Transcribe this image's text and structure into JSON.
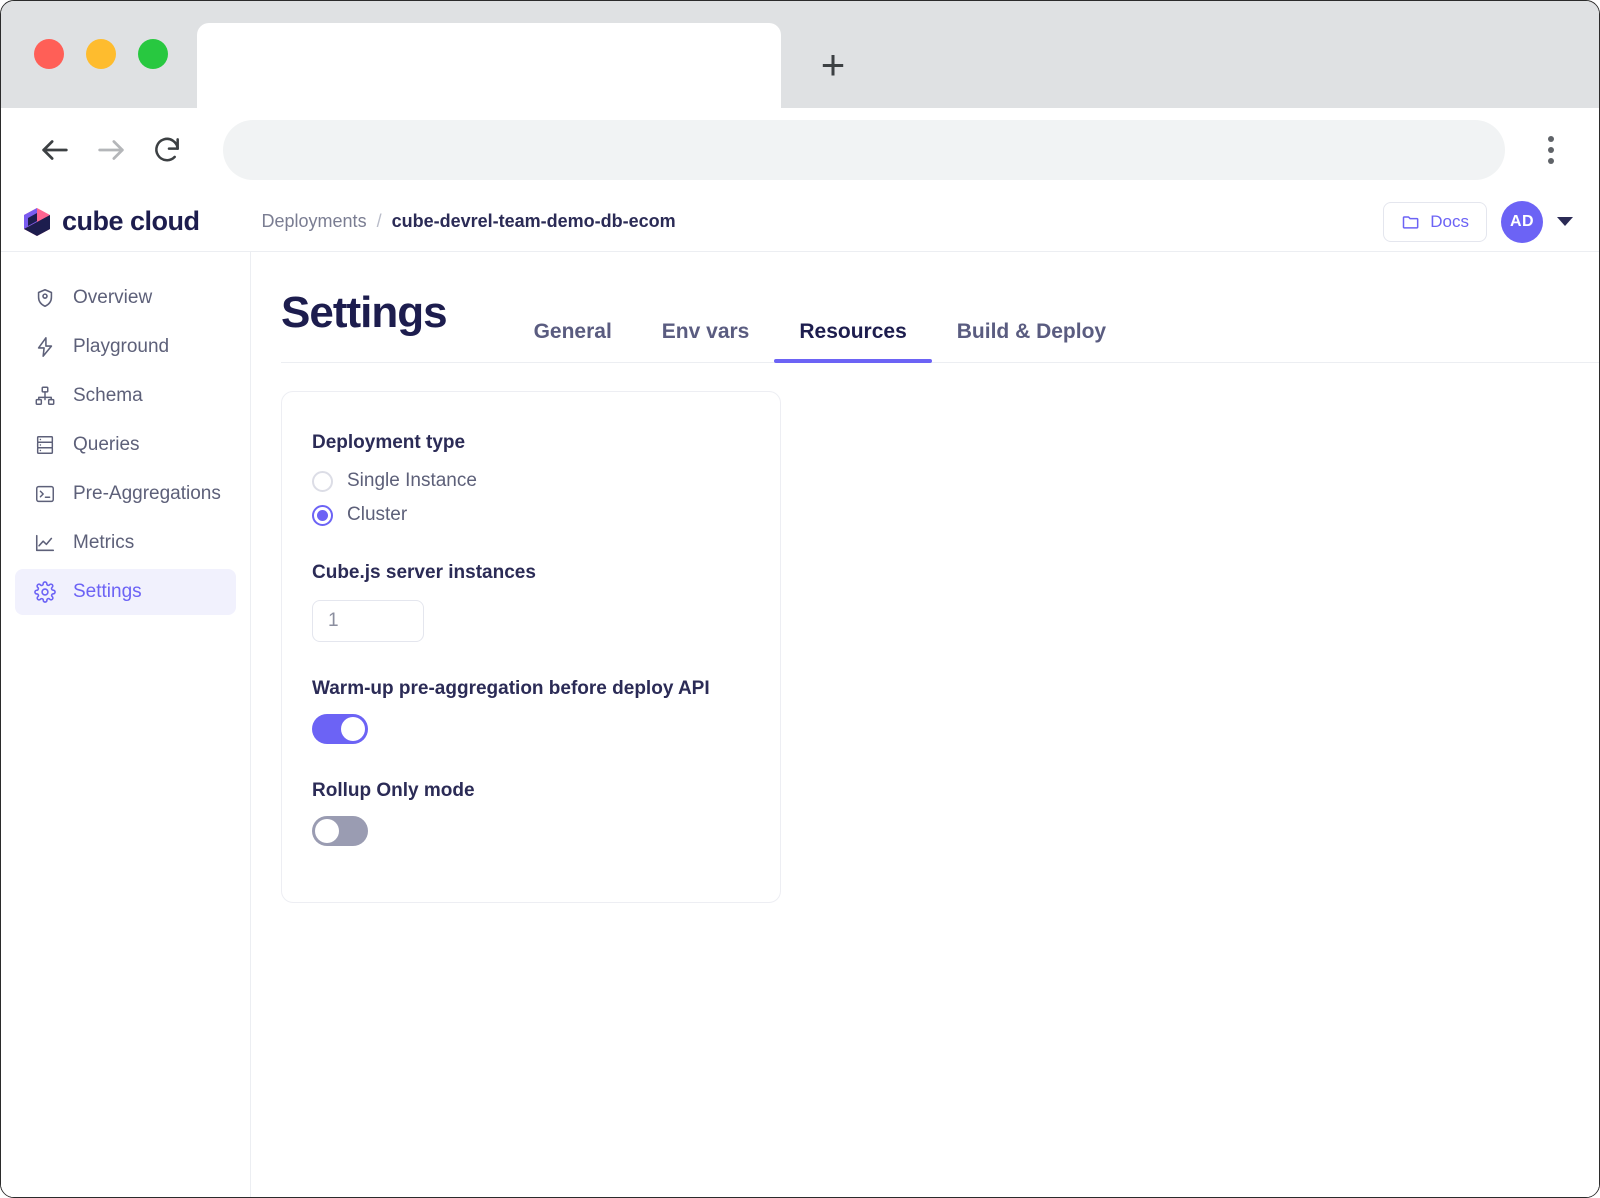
{
  "browser": {
    "tab_title": "",
    "url": "",
    "new_tab_label": "+",
    "back_icon": "back-arrow-icon",
    "forward_icon": "forward-arrow-icon",
    "reload_icon": "reload-icon",
    "menu_icon": "kebab-menu-icon"
  },
  "app": {
    "logo_text": "cube cloud",
    "breadcrumb": {
      "root": "Deployments",
      "separator": "/",
      "current": "cube-devrel-team-demo-db-ecom"
    },
    "docs_label": "Docs",
    "avatar_initials": "AD"
  },
  "sidebar": {
    "items": [
      {
        "label": "Overview",
        "icon": "shield-location-icon",
        "active": false
      },
      {
        "label": "Playground",
        "icon": "lightning-bolt-icon",
        "active": false
      },
      {
        "label": "Schema",
        "icon": "sitemap-icon",
        "active": false
      },
      {
        "label": "Queries",
        "icon": "server-stack-icon",
        "active": false
      },
      {
        "label": "Pre-Aggregations",
        "icon": "terminal-icon",
        "active": false
      },
      {
        "label": "Metrics",
        "icon": "line-chart-icon",
        "active": false
      },
      {
        "label": "Settings",
        "icon": "gear-icon",
        "active": true
      }
    ]
  },
  "page": {
    "title": "Settings",
    "tabs": [
      {
        "label": "General",
        "active": false
      },
      {
        "label": "Env vars",
        "active": false
      },
      {
        "label": "Resources",
        "active": true
      },
      {
        "label": "Build & Deploy",
        "active": false
      }
    ]
  },
  "settings": {
    "deployment_type": {
      "label": "Deployment type",
      "options": [
        {
          "label": "Single Instance",
          "selected": false
        },
        {
          "label": "Cluster",
          "selected": true
        }
      ]
    },
    "server_instances": {
      "label": "Cube.js server instances",
      "value": "1"
    },
    "warmup": {
      "label": "Warm-up pre-aggregation before deploy API",
      "state": "on"
    },
    "rollup_only": {
      "label": "Rollup Only mode",
      "state": "off"
    }
  },
  "colors": {
    "accent": "#6c63f5",
    "title": "#1d1d4e",
    "muted": "#5d6079",
    "toggle_off": "#9a9cb2",
    "sidebar_active_bg": "#f1f1fd"
  }
}
